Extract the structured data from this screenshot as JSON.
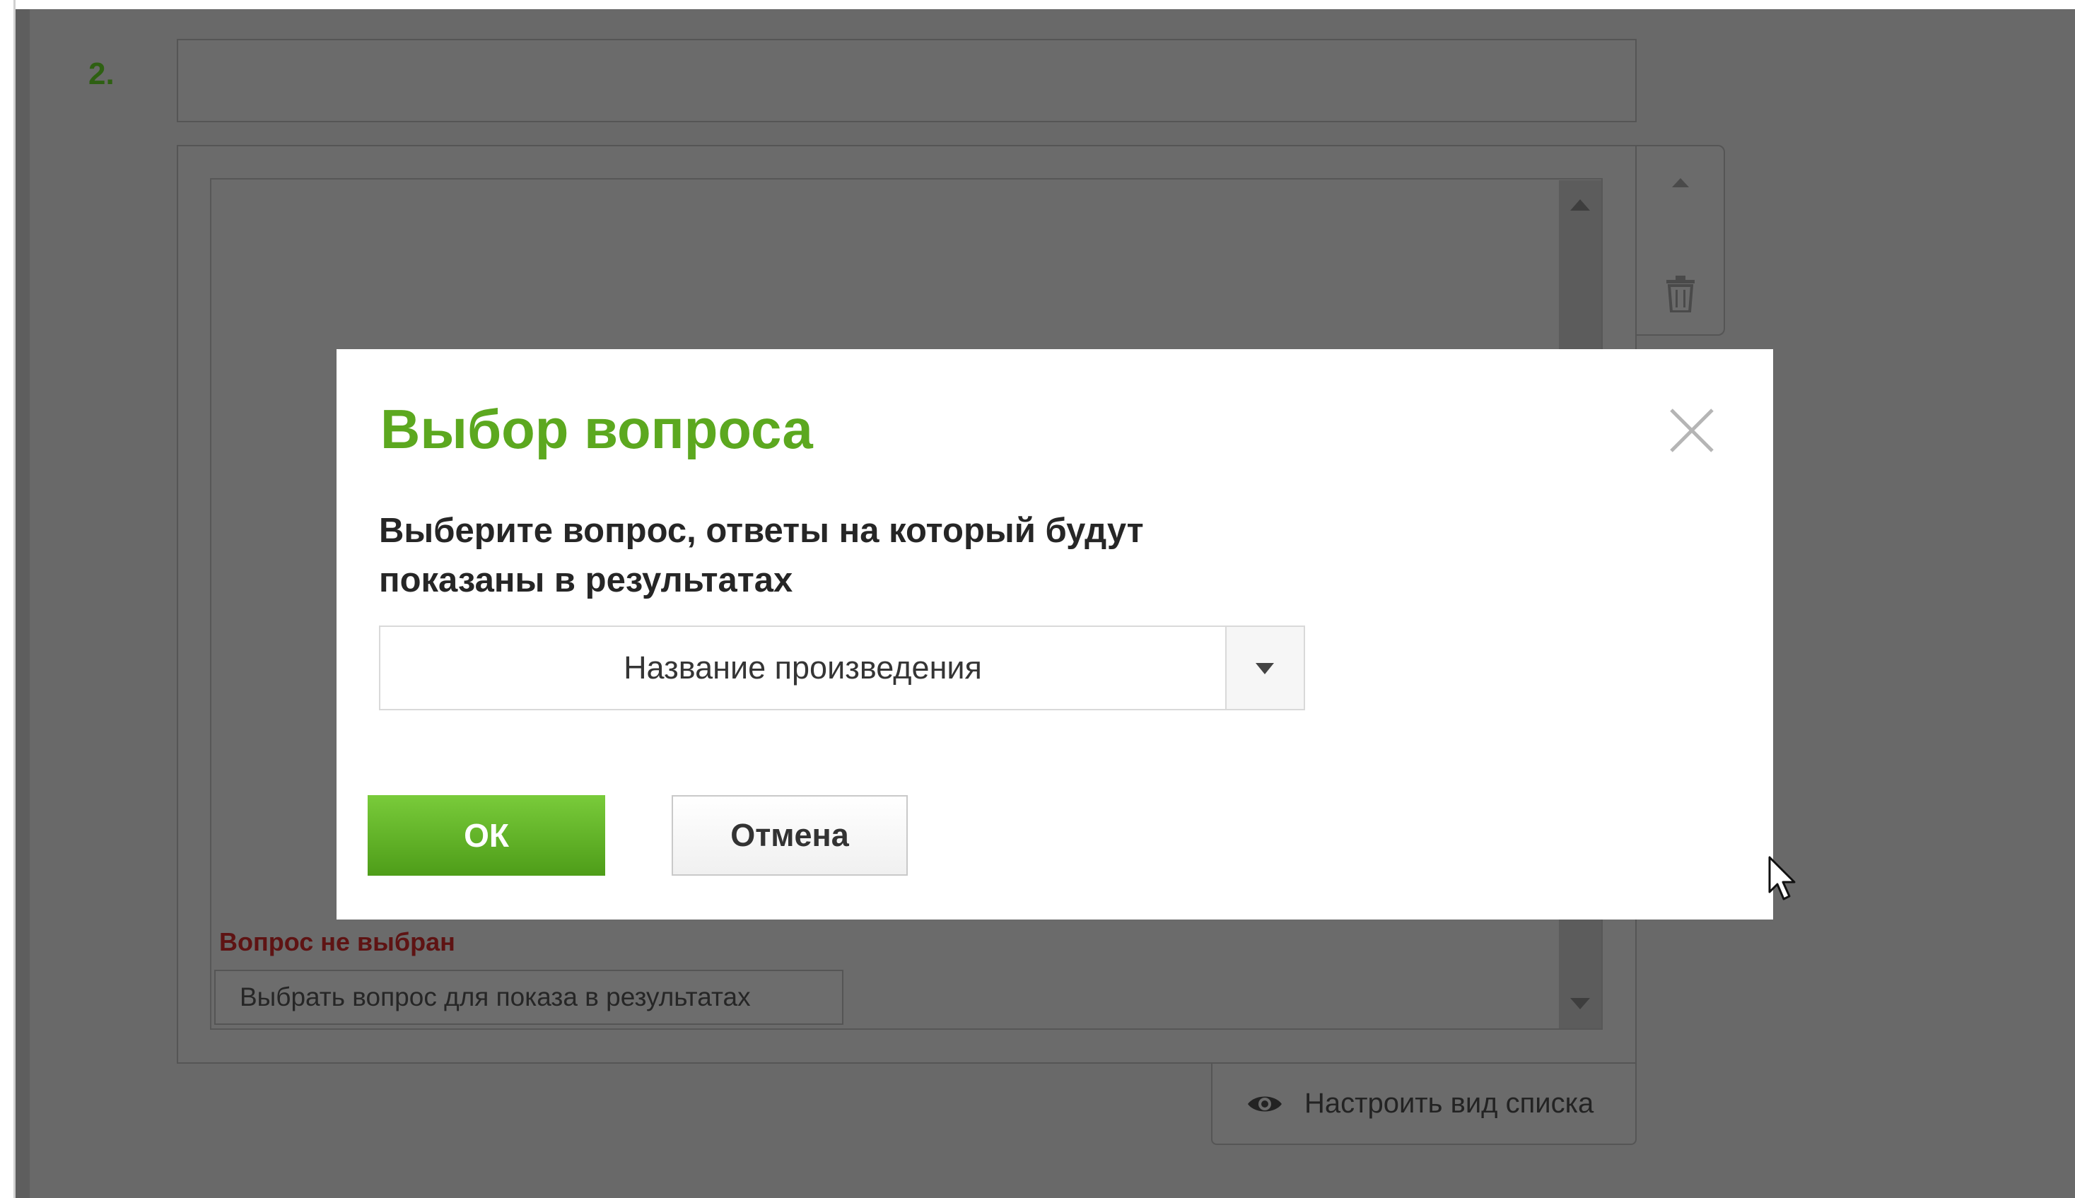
{
  "question": {
    "number": "2.",
    "error": "Вопрос не выбран",
    "choose_button": "Выбрать вопрос для показа в результатах",
    "list_view_button": "Настроить вид списка"
  },
  "modal": {
    "title": "Выбор вопроса",
    "description_line1": "Выберите вопрос, ответы на который будут",
    "description_line2": "показаны в результатах",
    "select_value": "Название произведения",
    "ok_label": "ОК",
    "cancel_label": "Отмена"
  },
  "colors": {
    "accent": "#5ca81f",
    "error": "#5e1313",
    "overlay": "#696969"
  },
  "icons": [
    "eye-icon",
    "trash-icon",
    "close-icon",
    "chevron-down-icon",
    "arrow-up-icon",
    "arrow-down-icon",
    "mouse-cursor-icon"
  ]
}
